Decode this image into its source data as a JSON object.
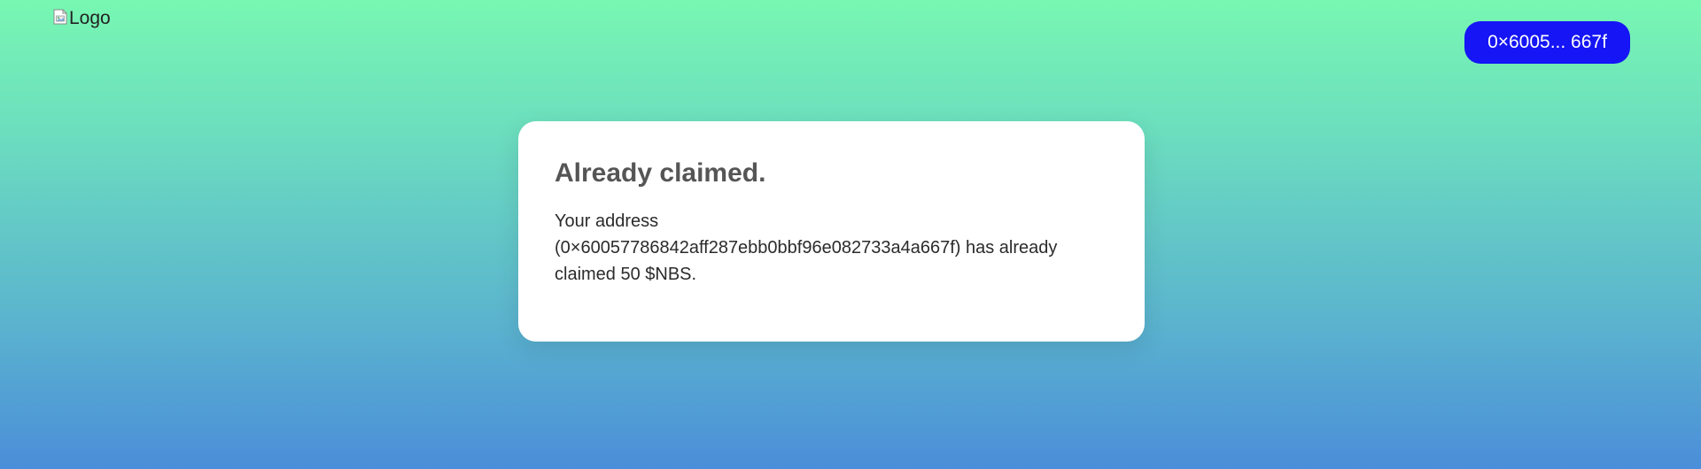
{
  "header": {
    "logo_alt": "Logo",
    "wallet_button_label": "0×6005... 667f"
  },
  "card": {
    "title": "Already claimed.",
    "message_line1": "Your address",
    "message_address": "(0×60057786842aff287ebb0bbf96e082733a4a667f) has already",
    "message_end": "claimed 50 $NBS."
  },
  "colors": {
    "wallet_button": "#1515f5",
    "card_background": "#ffffff",
    "title_text": "#555555",
    "gradient_top": "#78f7b2",
    "gradient_bottom": "#4b8ed9"
  },
  "icons": {
    "logo": "broken-image-icon"
  }
}
